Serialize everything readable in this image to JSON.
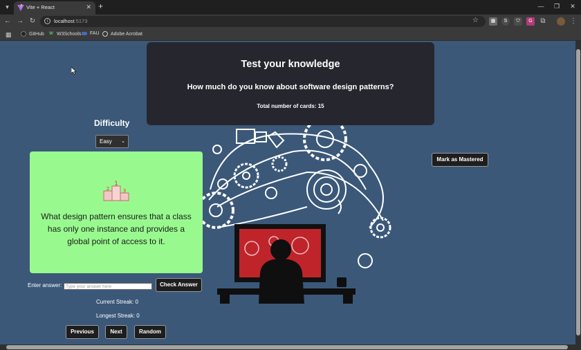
{
  "browser": {
    "tab_title": "Vite + React",
    "url_host": "localhost",
    "url_port": ":5173",
    "bookmarks": [
      {
        "label": "GitHub",
        "icon": "github-icon"
      },
      {
        "label": "W3Schools",
        "icon": "w3schools-icon"
      },
      {
        "label": "FAU",
        "icon": "fau-icon"
      },
      {
        "label": "Adobe Acrobat",
        "icon": "acrobat-icon"
      }
    ],
    "extension_letters": [
      "S"
    ]
  },
  "header": {
    "title": "Test your knowledge",
    "subtitle": "How much do you know about software design patterns?",
    "card_count_label": "Total number of cards: 15"
  },
  "difficulty": {
    "label": "Difficulty",
    "selected": "Easy"
  },
  "card": {
    "icon": "podium-icon",
    "question": "What design pattern ensures that a class has only one instance and provides a global point of access to it."
  },
  "answer": {
    "label": "Enter answer:",
    "placeholder": "Type your answer here",
    "check_label": "Check Answer"
  },
  "mastered_label": "Mark as Mastered",
  "streaks": {
    "current": "Current Streak: 0",
    "longest": "Longest Streak: 0"
  },
  "nav": {
    "previous": "Previous",
    "next": "Next",
    "random": "Random"
  },
  "colors": {
    "page_bg": "#3b5879",
    "card_bg": "#98fa8e",
    "header_bg": "#26272e",
    "button_bg": "#1e1e1e"
  }
}
